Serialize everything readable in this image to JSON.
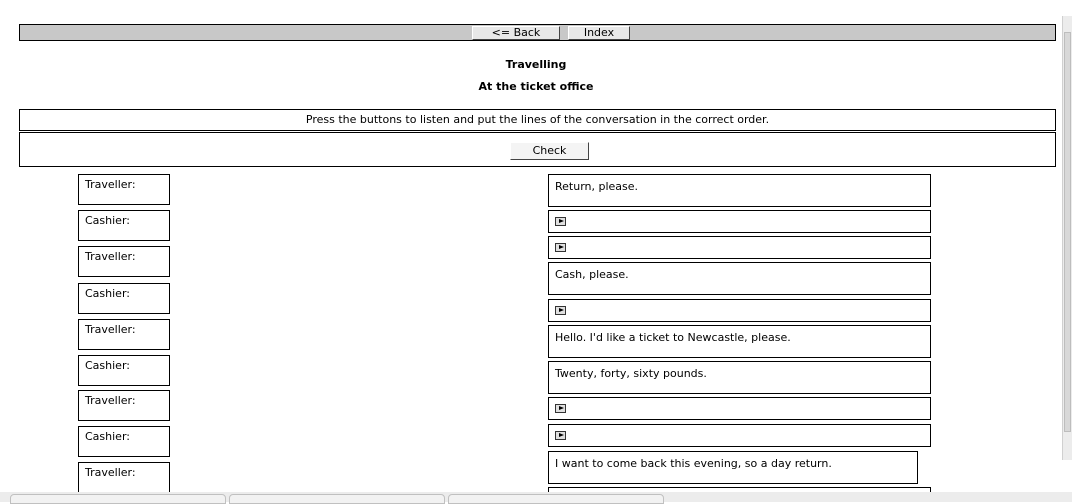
{
  "nav": {
    "back_label": "<= Back",
    "index_label": "Index"
  },
  "header": {
    "title": "Travelling",
    "subtitle": "At the ticket office"
  },
  "instructions": "Press the buttons to listen and put the lines of the conversation in the correct order.",
  "check_label": "Check",
  "speakers": [
    "Traveller:",
    "Cashier:",
    "Traveller:",
    "Cashier:",
    "Traveller:",
    "Cashier:",
    "Traveller:",
    "Cashier:",
    "Traveller:"
  ],
  "lines": [
    {
      "type": "text",
      "text": "Return, please."
    },
    {
      "type": "play",
      "icon": "play-icon"
    },
    {
      "type": "play",
      "icon": "play-icon"
    },
    {
      "type": "text",
      "text": "Cash, please."
    },
    {
      "type": "play",
      "icon": "play-icon"
    },
    {
      "type": "text",
      "text": "Hello. I'd like a ticket to Newcastle, please."
    },
    {
      "type": "text",
      "text": "Twenty, forty, sixty pounds."
    },
    {
      "type": "play",
      "icon": "play-icon"
    },
    {
      "type": "play",
      "icon": "play-icon"
    },
    {
      "type": "text",
      "text": "I want to come back this evening, so a day return."
    }
  ]
}
